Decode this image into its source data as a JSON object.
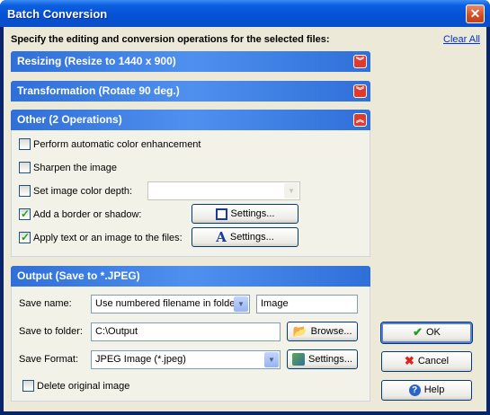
{
  "window": {
    "title": "Batch Conversion"
  },
  "heading": "Specify the editing and conversion operations for the selected files:",
  "clear_all": "Clear All",
  "panels": {
    "resizing": {
      "title": "Resizing (Resize to 1440 x 900)",
      "state": "collapsed"
    },
    "transformation": {
      "title": "Transformation (Rotate 90 deg.)",
      "state": "collapsed"
    },
    "other": {
      "title": "Other (2 Operations)",
      "state": "expanded",
      "options": [
        {
          "label": "Perform automatic color enhancement",
          "checked": false
        },
        {
          "label": "Sharpen the image",
          "checked": false
        },
        {
          "label": "Set image color depth:",
          "checked": false
        },
        {
          "label": "Add a border or shadow:",
          "checked": true
        },
        {
          "label": "Apply text or an image to the files:",
          "checked": true
        }
      ],
      "color_depth_value": "",
      "border_settings_label": "Settings...",
      "text_settings_label": "Settings..."
    },
    "output": {
      "title": "Output (Save to *.JPEG)",
      "save_name_label": "Save name:",
      "save_name_mode": "Use numbered filename in folder",
      "save_name_value": "Image",
      "save_folder_label": "Save to folder:",
      "save_folder_value": "C:\\Output",
      "browse_label": "Browse...",
      "save_format_label": "Save Format:",
      "save_format_value": "JPEG Image (*.jpeg)",
      "format_settings_label": "Settings...",
      "delete_original_label": "Delete original image",
      "delete_original_checked": false
    }
  },
  "buttons": {
    "ok": "OK",
    "cancel": "Cancel",
    "help": "Help"
  },
  "icons": {
    "close": "close-icon",
    "collapse": "chevron-double-down-icon",
    "expand": "chevron-double-up-icon",
    "border": "border-square-icon",
    "text": "text-a-icon",
    "folder": "folder-icon",
    "format_settings": "settings-icon",
    "ok": "checkmark-icon",
    "cancel": "x-icon",
    "help": "help-icon"
  },
  "colors": {
    "title_bar": "#0550d4",
    "panel_header": "#3f80e5",
    "dialog_bg": "#ece9d8",
    "link": "#0033cc"
  }
}
